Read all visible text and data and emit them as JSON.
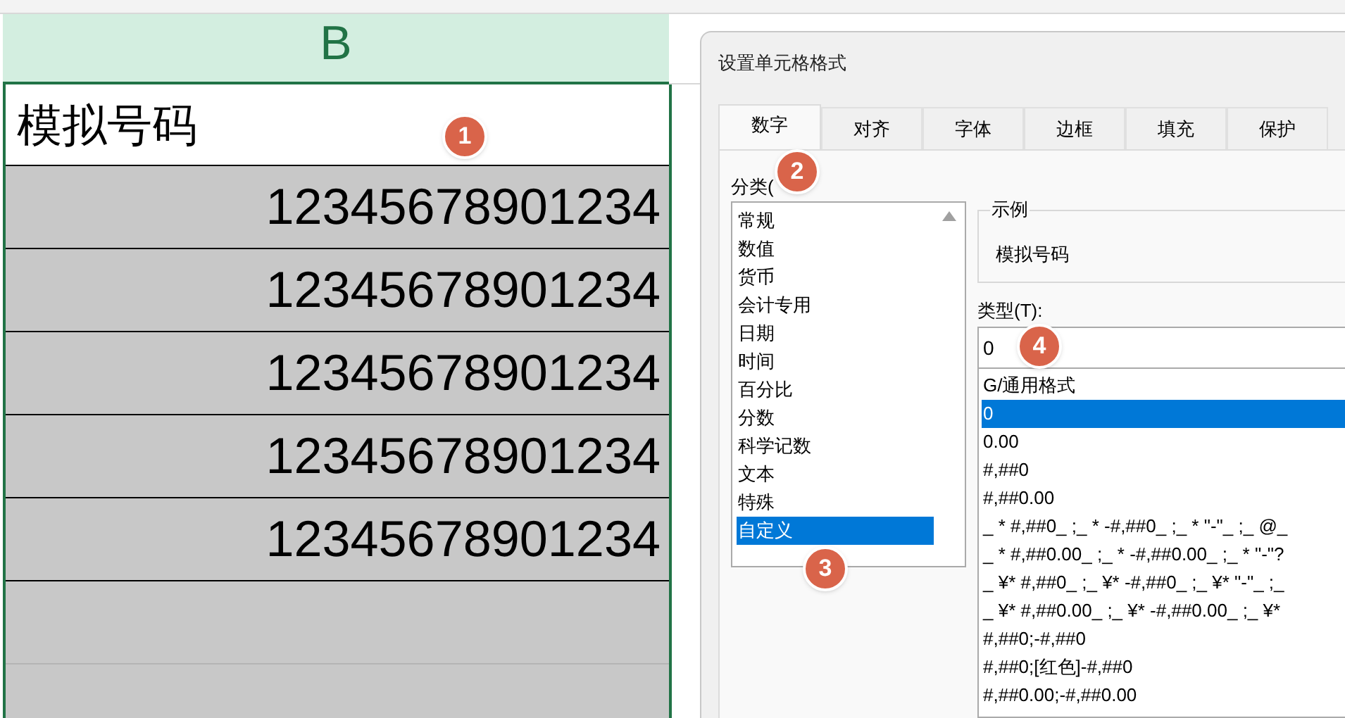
{
  "sheet": {
    "column_header": "B",
    "cells": [
      {
        "kind": "header",
        "text": "模拟号码"
      },
      {
        "kind": "number",
        "text": "12345678901234"
      },
      {
        "kind": "number",
        "text": "12345678901234"
      },
      {
        "kind": "number",
        "text": "12345678901234"
      },
      {
        "kind": "number",
        "text": "12345678901234"
      },
      {
        "kind": "number",
        "text": "12345678901234"
      }
    ]
  },
  "dialog": {
    "title": "设置单元格格式",
    "tabs": [
      {
        "label": "数字",
        "selected": true
      },
      {
        "label": "对齐",
        "selected": false
      },
      {
        "label": "字体",
        "selected": false
      },
      {
        "label": "边框",
        "selected": false
      },
      {
        "label": "填充",
        "selected": false
      },
      {
        "label": "保护",
        "selected": false
      }
    ],
    "category_label": "分类(",
    "categories": [
      {
        "label": "常规",
        "selected": false
      },
      {
        "label": "数值",
        "selected": false
      },
      {
        "label": "货币",
        "selected": false
      },
      {
        "label": "会计专用",
        "selected": false
      },
      {
        "label": "日期",
        "selected": false
      },
      {
        "label": "时间",
        "selected": false
      },
      {
        "label": "百分比",
        "selected": false
      },
      {
        "label": "分数",
        "selected": false
      },
      {
        "label": "科学记数",
        "selected": false
      },
      {
        "label": "文本",
        "selected": false
      },
      {
        "label": "特殊",
        "selected": false
      },
      {
        "label": "自定义",
        "selected": true
      }
    ],
    "sample_label": "示例",
    "sample_value": "模拟号码",
    "type_label": "类型(T):",
    "type_value": "0",
    "formats": [
      {
        "label": "G/通用格式",
        "selected": false
      },
      {
        "label": "0",
        "selected": true
      },
      {
        "label": "0.00",
        "selected": false
      },
      {
        "label": "#,##0",
        "selected": false
      },
      {
        "label": "#,##0.00",
        "selected": false
      },
      {
        "label": "_ * #,##0_ ;_ * -#,##0_ ;_ * \"-\"_ ;_ @_",
        "selected": false
      },
      {
        "label": "_ * #,##0.00_ ;_ * -#,##0.00_ ;_ * \"-\"?",
        "selected": false
      },
      {
        "label": "_ ¥* #,##0_ ;_ ¥* -#,##0_ ;_ ¥* \"-\"_ ;_",
        "selected": false
      },
      {
        "label": "_ ¥* #,##0.00_ ;_ ¥* -#,##0.00_ ;_ ¥*",
        "selected": false
      },
      {
        "label": "#,##0;-#,##0",
        "selected": false
      },
      {
        "label": "#,##0;[红色]-#,##0",
        "selected": false
      },
      {
        "label": "#,##0.00;-#,##0.00",
        "selected": false
      }
    ]
  },
  "annotations": [
    {
      "text": "1"
    },
    {
      "text": "2"
    },
    {
      "text": "3"
    },
    {
      "text": "4"
    }
  ]
}
